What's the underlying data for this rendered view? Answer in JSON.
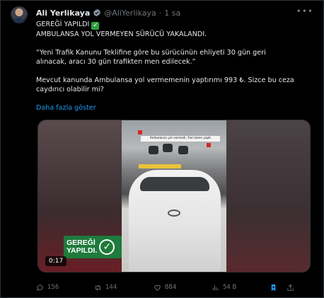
{
  "author": {
    "name": "Ali Yerlikaya",
    "handle": "@AliYerlikaya",
    "separator": "·",
    "time": "1 sa",
    "verified_icon": "verified-badge-icon"
  },
  "post": {
    "line1": "GEREĞİ YAPILDI",
    "line1_emoji": "✓",
    "line2": "AMBULANSA YOL VERMEYEN SÜRÜCÜ YAKALANDI.",
    "quote_line1": "“Yeni Trafik Kanunu Teklifine göre bu sürücünün ehliyeti 30 gün geri",
    "quote_line2": "alınacak, aracı 30 gün trafikten men edilecek.”",
    "para_line1": "Mevcut kanunda Ambulansa yol vermemenin yaptırımı 993 ₺. Sizce bu ceza",
    "para_line2": "caydırıcı olabilir mi?",
    "show_more": "Daha fazla göster"
  },
  "media": {
    "banner_text": "Ambulansa yol vermedi, fren bene yaptı",
    "badge_line1": "GEREĞİ",
    "badge_line2": "YAPILDI.",
    "badge_check": "✓",
    "duration": "0:17"
  },
  "actions": {
    "replies": "156",
    "reposts": "144",
    "likes": "884",
    "views": "54 B"
  },
  "colors": {
    "accent": "#1d9bf0",
    "muted": "#71767b",
    "badge_green": "#1f7a3c"
  }
}
